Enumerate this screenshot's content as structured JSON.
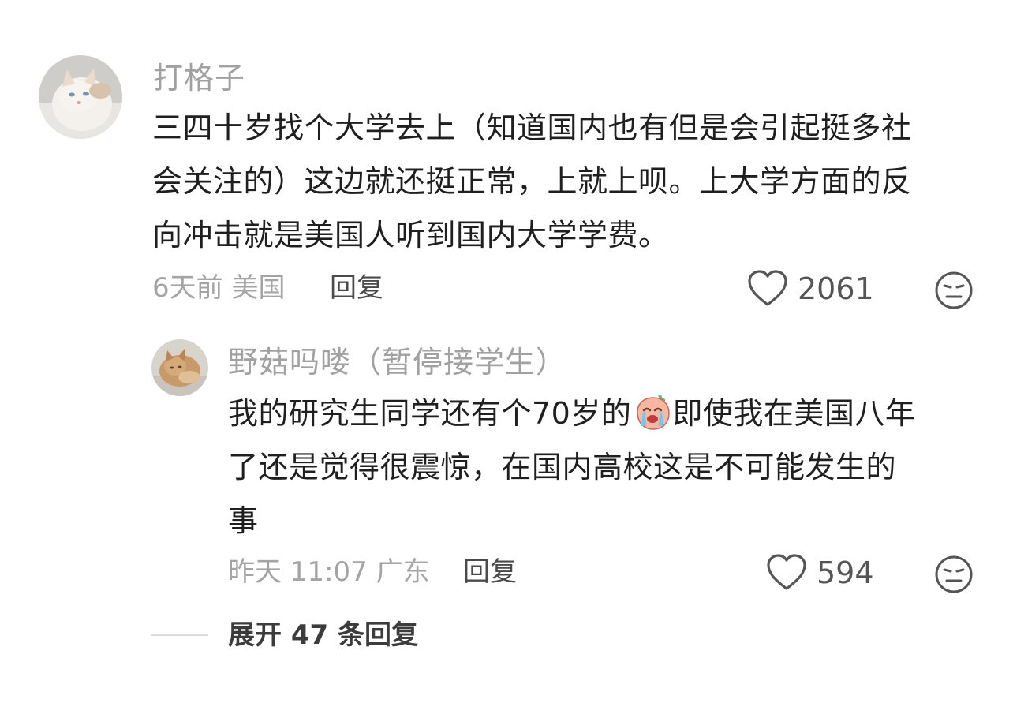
{
  "comment": {
    "username": "打格子",
    "lines": [
      "三四十岁找个大学去上（知道国内也有但是会引起挺多社",
      "会关注的）这边就还挺正常，上就上呗。上大学方面的反",
      "向冲击就是美国人听到国内大学学费。"
    ],
    "meta": "6天前 美国",
    "reply_label": "回复",
    "likes": "2061",
    "avatar_icon": "cat-avatar-icon",
    "reaction_icon": "neutral-face-icon"
  },
  "reply": {
    "username": "野菇吗喽（暂停接学生）",
    "line1_before": "我的研究生同学还有个70岁的",
    "line1_after": "即使我在美国八年",
    "line2": "了还是觉得很震惊，在国内高校这是不可能发生的",
    "line3": "事",
    "meta": "昨天 11:07 广东",
    "reply_label": "回复",
    "likes": "594",
    "emoji_icon": "crying-face-icon",
    "avatar_icon": "cat-avatar-icon",
    "reaction_icon": "neutral-face-icon"
  },
  "expand_label": "展开 47 条回复"
}
